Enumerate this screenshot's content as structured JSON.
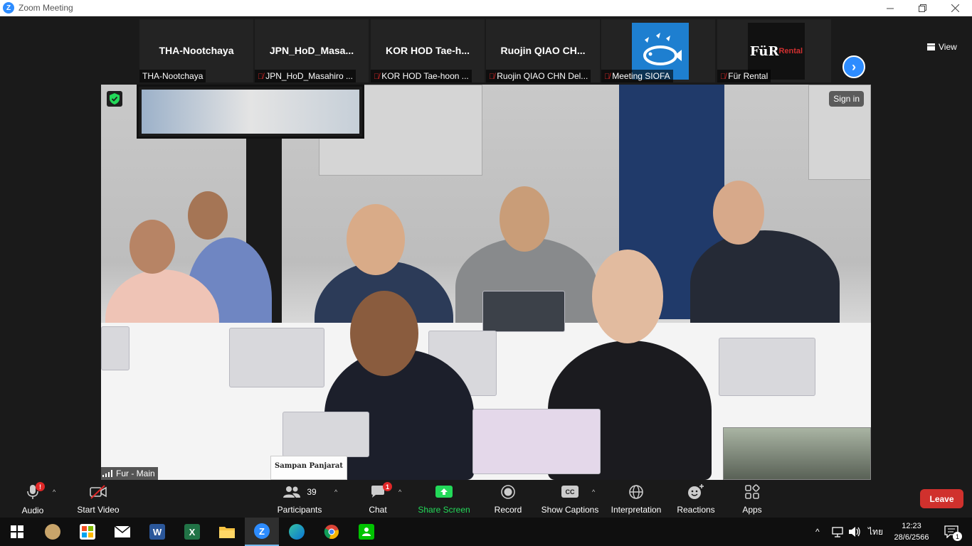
{
  "window": {
    "title": "Zoom Meeting",
    "app_icon_letter": "Z"
  },
  "participants_strip": [
    {
      "big_name": "THA-Nootchaya",
      "label": "THA-Nootchaya",
      "muted": false
    },
    {
      "big_name": "JPN_HoD_Masa...",
      "label": "JPN_HoD_Masahiro ...",
      "muted": true
    },
    {
      "big_name": "KOR HOD Tae-h...",
      "label": "KOR HOD Tae-hoon ...",
      "muted": true
    },
    {
      "big_name": "Ruojin QIAO CH...",
      "label": "Ruojin QIAO CHN Del...",
      "muted": true
    },
    {
      "big_name": "",
      "label": "Meeting SIOFA",
      "muted": true,
      "avatar": "siofa-logo"
    },
    {
      "big_name": "",
      "label": "Für Rental",
      "muted": true,
      "avatar": "fur-rental-logo",
      "logo_text": "FüR",
      "logo_subtext": "Rental"
    }
  ],
  "view_button": {
    "label": "View"
  },
  "main_video": {
    "speaker_label": "Fur - Main",
    "sign_in_label": "Sign in",
    "placard_text": "Sampan Panjarat"
  },
  "toolbar": {
    "audio": {
      "label": "Audio",
      "badge": "!"
    },
    "video": {
      "label": "Start Video"
    },
    "participants": {
      "label": "Participants",
      "count": "39"
    },
    "chat": {
      "label": "Chat",
      "badge": "1"
    },
    "share": {
      "label": "Share Screen"
    },
    "record": {
      "label": "Record"
    },
    "captions": {
      "label": "Show Captions",
      "icon_text": "CC"
    },
    "interpretation": {
      "label": "Interpretation"
    },
    "reactions": {
      "label": "Reactions"
    },
    "apps": {
      "label": "Apps"
    },
    "leave": {
      "label": "Leave"
    }
  },
  "taskbar": {
    "apps": [
      "start",
      "paint",
      "store",
      "mail",
      "word",
      "excel",
      "explorer",
      "zoom",
      "edge",
      "chrome",
      "line"
    ],
    "language": "ไทย",
    "time": "12:23",
    "date": "28/6/2566",
    "notifications": "1"
  },
  "colors": {
    "zoom_blue": "#2D8CFF",
    "share_green": "#23D959",
    "leave_red": "#D0312D",
    "mute_red": "#E02828"
  }
}
